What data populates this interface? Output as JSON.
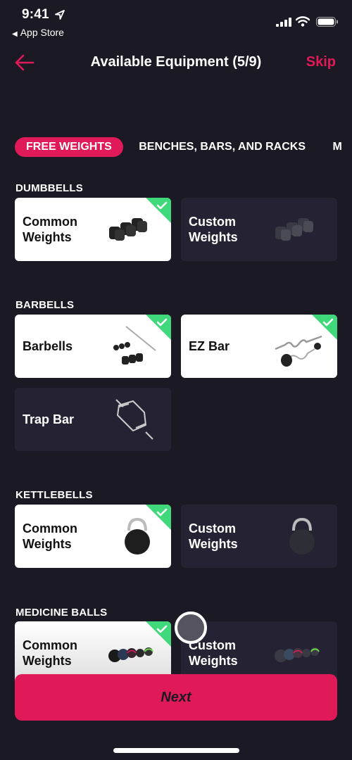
{
  "status_bar": {
    "time": "9:41",
    "back_app_label": "App Store"
  },
  "nav": {
    "title": "Available Equipment (5/9)",
    "skip_label": "Skip"
  },
  "tabs": [
    {
      "label": "FREE WEIGHTS",
      "active": true
    },
    {
      "label": "BENCHES, BARS, AND RACKS",
      "active": false
    },
    {
      "label": "M",
      "active": false
    }
  ],
  "sections": [
    {
      "title": "DUMBBELLS",
      "items": [
        {
          "label": "Common Weights",
          "selected": true,
          "icon": "dumbbells-icon"
        },
        {
          "label": "Custom Weights",
          "selected": false,
          "icon": "dumbbells-icon"
        }
      ]
    },
    {
      "title": "BARBELLS",
      "items": [
        {
          "label": "Barbells",
          "selected": true,
          "icon": "barbell-icon"
        },
        {
          "label": "EZ Bar",
          "selected": true,
          "icon": "ez-bar-icon"
        },
        {
          "label": "Trap Bar",
          "selected": false,
          "icon": "trap-bar-icon"
        }
      ]
    },
    {
      "title": "KETTLEBELLS",
      "items": [
        {
          "label": "Common Weights",
          "selected": true,
          "icon": "kettlebell-icon"
        },
        {
          "label": "Custom Weights",
          "selected": false,
          "icon": "kettlebell-icon"
        }
      ]
    },
    {
      "title": "MEDICINE BALLS",
      "items": [
        {
          "label": "Common Weights",
          "selected": true,
          "icon": "medicine-balls-icon"
        },
        {
          "label": "Custom Weights",
          "selected": false,
          "icon": "medicine-balls-icon"
        }
      ]
    }
  ],
  "next_label": "Next",
  "colors": {
    "accent": "#e01a59",
    "check": "#3fd87a",
    "background": "#1b1a24",
    "card_unselected": "#252333"
  }
}
